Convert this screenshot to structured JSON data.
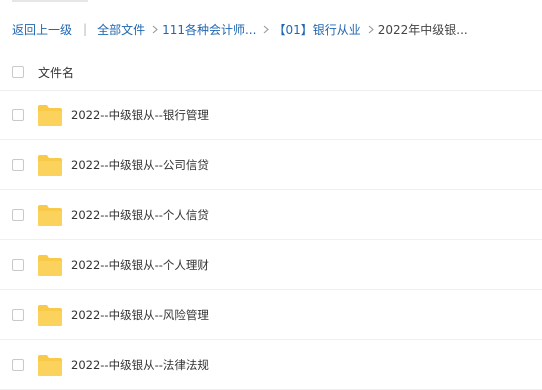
{
  "breadcrumb": {
    "back_label": "返回上一级",
    "separator": "|",
    "items": [
      {
        "label": "全部文件",
        "link": true
      },
      {
        "label": "111各种会计师...",
        "link": true
      },
      {
        "label": "【01】银行从业",
        "link": true
      },
      {
        "label": "2022年中级银...",
        "link": false
      }
    ]
  },
  "file_list": {
    "header_label": "文件名",
    "folder_color": "#f9c94a",
    "rows": [
      {
        "icon": "folder-icon",
        "name": "2022--中级银从--银行管理"
      },
      {
        "icon": "folder-icon",
        "name": "2022--中级银从--公司信贷"
      },
      {
        "icon": "folder-icon",
        "name": "2022--中级银从--个人信贷"
      },
      {
        "icon": "folder-icon",
        "name": "2022--中级银从--个人理财"
      },
      {
        "icon": "folder-icon",
        "name": "2022--中级银从--风险管理"
      },
      {
        "icon": "folder-icon",
        "name": "2022--中级银从--法律法规"
      }
    ]
  },
  "colors": {
    "link": "#1f67b1",
    "text": "#333333"
  }
}
